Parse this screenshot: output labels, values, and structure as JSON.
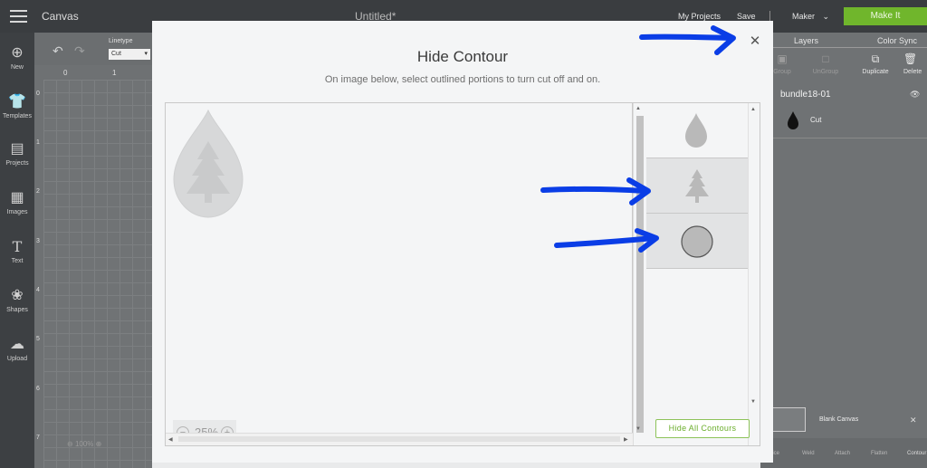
{
  "topbar": {
    "app_title": "Canvas",
    "doc_title": "Untitled*",
    "my_projects": "My Projects",
    "save": "Save",
    "machine": "Maker",
    "make_it": "Make It"
  },
  "sidebar": {
    "items": [
      {
        "label": "New",
        "icon": "plus-circle-icon"
      },
      {
        "label": "Templates",
        "icon": "shirt-icon"
      },
      {
        "label": "Projects",
        "icon": "notebook-icon"
      },
      {
        "label": "Images",
        "icon": "image-icon"
      },
      {
        "label": "Text",
        "icon": "text-icon"
      },
      {
        "label": "Shapes",
        "icon": "shapes-icon"
      },
      {
        "label": "Upload",
        "icon": "upload-icon"
      }
    ]
  },
  "canvas": {
    "linetype_label": "Linetype",
    "linetype_value": "Cut",
    "ruler_top": [
      "0",
      "1"
    ],
    "ruler_left": [
      "0",
      "1",
      "2",
      "3",
      "4",
      "5",
      "6",
      "7"
    ],
    "zoom": "100%"
  },
  "right_panel": {
    "tabs": [
      "Layers",
      "Color Sync"
    ],
    "tools": [
      "Group",
      "UnGroup",
      "Duplicate",
      "Delete"
    ],
    "layer_name": "bundle18-01",
    "layer_op": "Cut",
    "blank_canvas": "Blank Canvas",
    "bottom_tools": [
      "Slice",
      "Weld",
      "Attach",
      "Flatten",
      "Contour"
    ]
  },
  "modal": {
    "title": "Hide Contour",
    "subtitle": "On image below, select outlined portions to turn cut off and on.",
    "zoom": "25%",
    "hide_all": "Hide All Contours",
    "contours": [
      "teardrop",
      "tree",
      "circle"
    ]
  },
  "colors": {
    "accent_green": "#70b62c",
    "annotation_blue": "#0a3de6",
    "contour_gray": "#b9b9b9"
  }
}
